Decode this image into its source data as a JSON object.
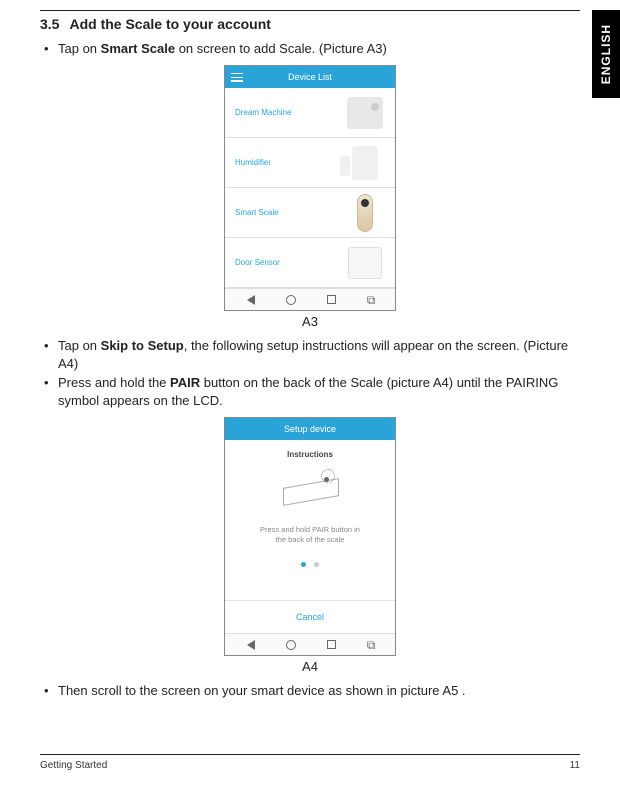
{
  "language_tab": "ENGLISH",
  "heading": {
    "number": "3.5",
    "title": "Add the Scale to your account"
  },
  "bullets": {
    "b1_pre": "Tap on ",
    "b1_bold": "Smart Scale",
    "b1_post": " on screen to add Scale. (Picture A3)",
    "b2_pre": "Tap on ",
    "b2_bold": "Skip to Setup",
    "b2_post": ", the following setup instructions will appear on the screen. (Picture A4)",
    "b3_pre": "Press and hold the ",
    "b3_bold": "PAIR",
    "b3_post": " button on the back of the Scale (picture A4) until the PAIRING symbol appears on the LCD.",
    "b4": "Then scroll to the screen on your smart device as shown in picture A5 ."
  },
  "phone1": {
    "header": "Device List",
    "items": [
      "Dream Machine",
      "Humidifier",
      "Smart Scale",
      "Door Sensor"
    ]
  },
  "caption_a3": "A3",
  "phone2": {
    "header": "Setup device",
    "instructions_label": "Instructions",
    "body_line1": "Press and hold PAIR button in",
    "body_line2": "the back of the scale",
    "cancel": "Cancel"
  },
  "caption_a4": "A4",
  "footer": {
    "section": "Getting Started",
    "page": "11"
  }
}
